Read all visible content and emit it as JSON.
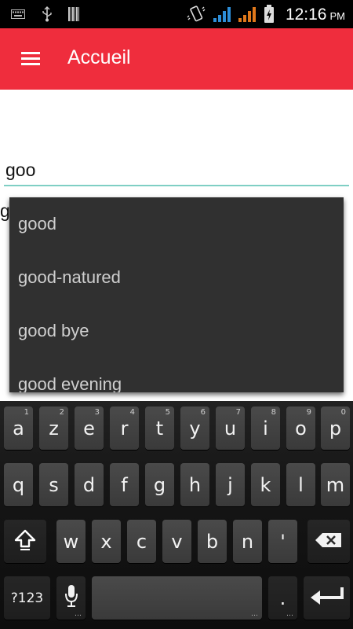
{
  "status_bar": {
    "time": "12:16",
    "ampm": "PM",
    "icons": [
      "keyboard-icon",
      "usb-icon",
      "barcode-icon",
      "vibrate-icon",
      "signal-icon",
      "signal-icon",
      "battery-charging-icon"
    ],
    "colors": {
      "signal_blue": "#2d8ed8",
      "signal_orange": "#e0781a"
    }
  },
  "app_bar": {
    "title": "Accueil",
    "menu_icon": "hamburger-menu-icon",
    "background": "#ef2d3d"
  },
  "search": {
    "value": "goo",
    "underline_color": "#7fcfc4",
    "behind_text": "g"
  },
  "suggestions": [
    "good",
    "good-natured",
    "good bye",
    "good evening"
  ],
  "keyboard": {
    "row1": [
      {
        "label": "a",
        "hint": "1"
      },
      {
        "label": "z",
        "hint": "2"
      },
      {
        "label": "e",
        "hint": "3"
      },
      {
        "label": "r",
        "hint": "4"
      },
      {
        "label": "t",
        "hint": "5"
      },
      {
        "label": "y",
        "hint": "6"
      },
      {
        "label": "u",
        "hint": "7"
      },
      {
        "label": "i",
        "hint": "8"
      },
      {
        "label": "o",
        "hint": "9"
      },
      {
        "label": "p",
        "hint": "0"
      }
    ],
    "row2": [
      "q",
      "s",
      "d",
      "f",
      "g",
      "h",
      "j",
      "k",
      "l",
      "m"
    ],
    "row3": [
      "w",
      "x",
      "c",
      "v",
      "b",
      "n",
      "'"
    ],
    "shift_icon": "shift-arrow-icon",
    "backspace_icon": "backspace-icon",
    "symbols_label": "?123",
    "mic_icon": "microphone-icon",
    "period_label": ".",
    "enter_icon": "enter-arrow-icon"
  }
}
